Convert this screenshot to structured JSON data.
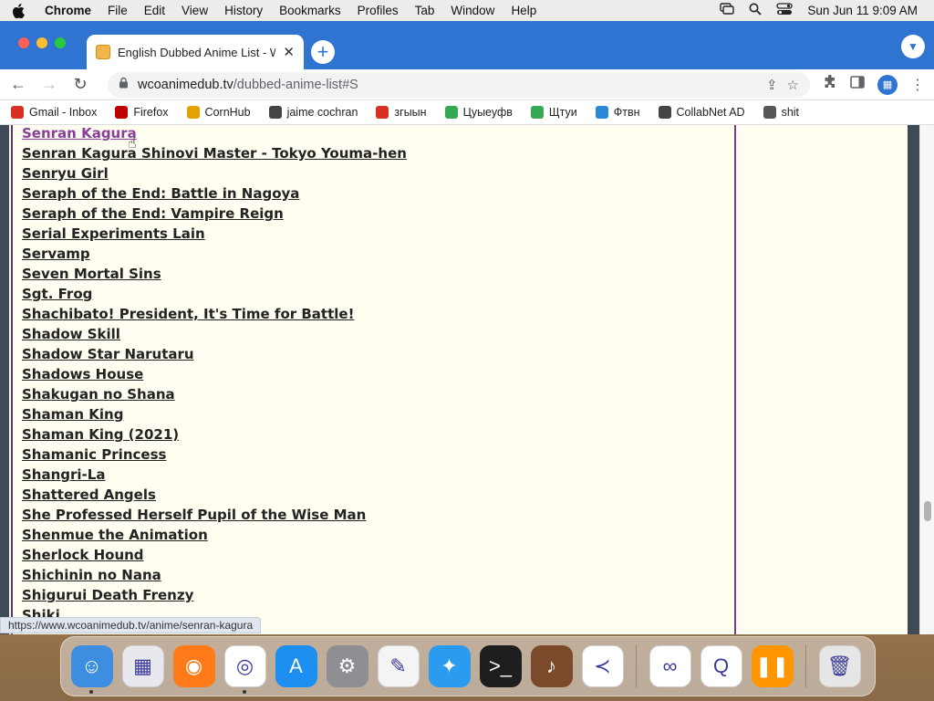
{
  "menubar": {
    "app_name": "Chrome",
    "items": [
      "File",
      "Edit",
      "View",
      "History",
      "Bookmarks",
      "Profiles",
      "Tab",
      "Window",
      "Help"
    ],
    "datetime": "Sun Jun 11  9:09 AM"
  },
  "browser": {
    "tab_title": "English Dubbed Anime List - W",
    "url_host": "wcoanimedub.tv",
    "url_path": "/dubbed-anime-list#S"
  },
  "bookmarks": [
    {
      "label": "Gmail - Inbox",
      "icon": "gmail-icon",
      "color": "#d93025"
    },
    {
      "label": "Firefox",
      "icon": "firefox-icon",
      "color": "#c00000"
    },
    {
      "label": "CornHub",
      "icon": "ch-icon",
      "color": "#e8a000"
    },
    {
      "label": "jaime cochran",
      "icon": "globe-icon",
      "color": "#444444"
    },
    {
      "label": "згыын",
      "icon": "gmail-icon",
      "color": "#d93025"
    },
    {
      "label": "Цуыеуфв",
      "icon": "maps-pin-icon",
      "color": "#34a853"
    },
    {
      "label": "Щтуи",
      "icon": "maps-pin-icon",
      "color": "#34a853"
    },
    {
      "label": "Фтвн",
      "icon": "bookmark-icon",
      "color": "#2b8ad8"
    },
    {
      "label": "CollabNet AD",
      "icon": "globe-icon",
      "color": "#444444"
    },
    {
      "label": "shit",
      "icon": "hfs-icon",
      "color": "#555555"
    }
  ],
  "anime_list": [
    "Senran Kagura",
    "Senran Kagura Shinovi Master - Tokyo Youma-hen",
    "Senryu Girl",
    "Seraph of the End: Battle in Nagoya",
    "Seraph of the End: Vampire Reign",
    "Serial Experiments Lain",
    "Servamp",
    "Seven Mortal Sins",
    "Sgt. Frog",
    "Shachibato! President, It's Time for Battle!",
    "Shadow Skill",
    "Shadow Star Narutaru",
    "Shadows House",
    "Shakugan no Shana",
    "Shaman King",
    "Shaman King (2021)",
    "Shamanic Princess",
    "Shangri-La",
    "Shattered Angels",
    "She Professed Herself Pupil of the Wise Man",
    "Shenmue the Animation",
    "Sherlock Hound",
    "Shichinin no Nana",
    "Shigurui Death Frenzy",
    "Shiki"
  ],
  "status_url": "https://www.wcoanimedub.tv/anime/senran-kagura",
  "dock": [
    {
      "name": "finder-icon",
      "color": "#3d8de0",
      "glyph": "☺",
      "running": true
    },
    {
      "name": "launchpad-icon",
      "color": "#e8e8ee",
      "glyph": "▦",
      "running": false
    },
    {
      "name": "firefox-icon",
      "color": "#ff7a18",
      "glyph": "◉",
      "running": false
    },
    {
      "name": "chrome-icon",
      "color": "#ffffff",
      "glyph": "◎",
      "running": true
    },
    {
      "name": "app-store-icon",
      "color": "#1d8ff0",
      "glyph": "A",
      "running": false
    },
    {
      "name": "system-settings-icon",
      "color": "#8e8e93",
      "glyph": "⚙",
      "running": false
    },
    {
      "name": "textedit-icon",
      "color": "#f4f4f4",
      "glyph": "✎",
      "running": false
    },
    {
      "name": "safari-icon",
      "color": "#2b9bf0",
      "glyph": "✦",
      "running": false
    },
    {
      "name": "terminal-icon",
      "color": "#1e1e1e",
      "glyph": ">_",
      "running": false
    },
    {
      "name": "instruments-icon",
      "color": "#7a4a2a",
      "glyph": "♪",
      "running": false
    },
    {
      "name": "vscode-icon",
      "color": "#ffffff",
      "glyph": "≺",
      "running": false
    },
    {
      "name": "visual-studio-icon",
      "color": "#ffffff",
      "glyph": "∞",
      "running": false
    },
    {
      "name": "quicktime-icon",
      "color": "#ffffff",
      "glyph": "Q",
      "running": false
    },
    {
      "name": "books-icon",
      "color": "#ff9500",
      "glyph": "❚❚",
      "running": false
    },
    {
      "name": "trash-icon",
      "color": "#e6e6e6",
      "glyph": "🗑",
      "running": false
    }
  ]
}
